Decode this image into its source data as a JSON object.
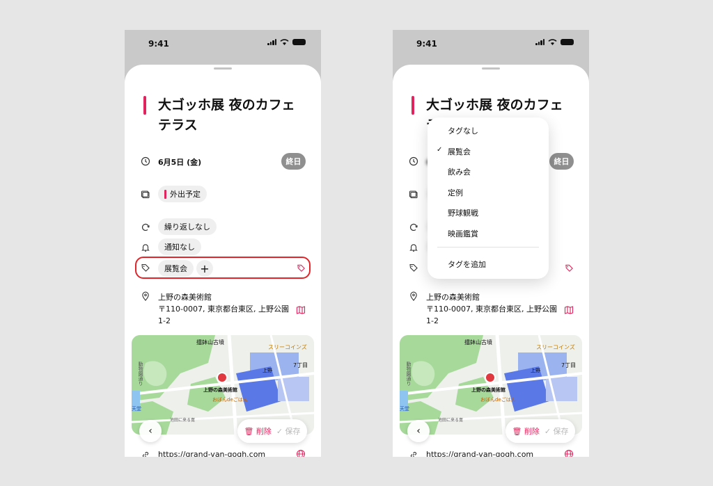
{
  "status_bar": {
    "time": "9:41"
  },
  "event": {
    "title": "大ゴッホ展 夜のカフェテラス",
    "date": "6月5日 (金)",
    "all_day": "終日",
    "calendar": "外出予定",
    "repeat": "繰り返しなし",
    "notification": "通知なし",
    "tag": "展覧会",
    "add_tag": "+",
    "location_name": "上野の森美術館",
    "location_address": "〒110-0007, 東京都台東区, 上野公園1-2",
    "url": "https://grand-van-gogh.com"
  },
  "map": {
    "labels": [
      "擂鉢山古墳",
      "スリーコインズ",
      "上野",
      "7丁目",
      "上野の森美術館",
      "おぼんdeごはん",
      "天堂",
      "池田に来る寛",
      "動物園通り"
    ]
  },
  "actions": {
    "delete": "削除",
    "save": "保存",
    "back": "‹"
  },
  "dropdown": {
    "items": [
      "タグなし",
      "展覧会",
      "飲み会",
      "定例",
      "野球観戦",
      "映画鑑賞"
    ],
    "selected": "展覧会",
    "check": "✓",
    "add_label": "タグを追加"
  },
  "colors": {
    "accent": "#e0245e",
    "highlight": "#e0242a"
  }
}
